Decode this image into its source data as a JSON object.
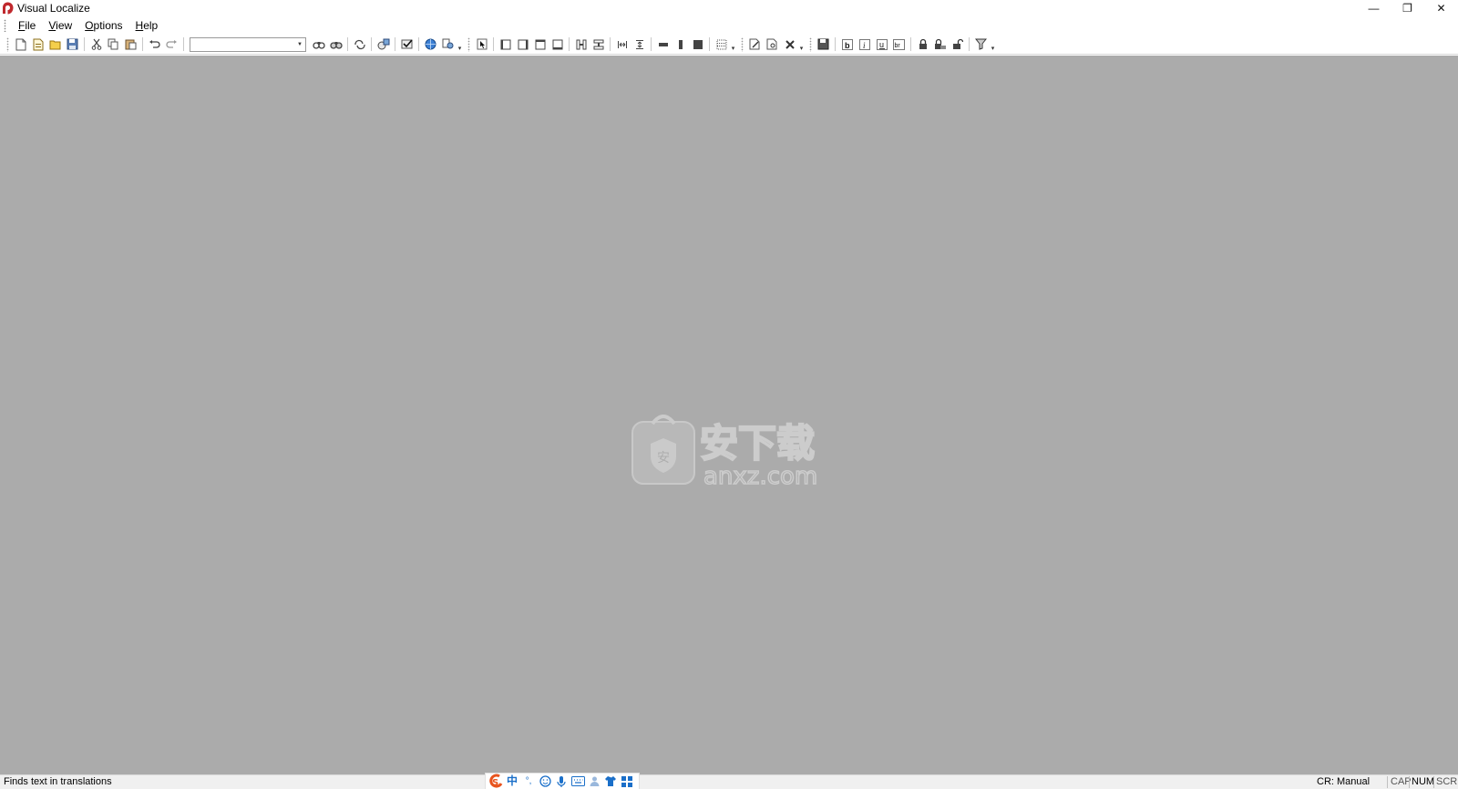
{
  "window": {
    "title": "Visual Localize",
    "controls": {
      "minimize": "—",
      "restore": "❐",
      "close": "✕"
    }
  },
  "menu": {
    "items": [
      {
        "accel": "F",
        "rest": "ile"
      },
      {
        "accel": "V",
        "rest": "iew"
      },
      {
        "accel": "O",
        "rest": "ptions"
      },
      {
        "accel": "H",
        "rest": "elp"
      }
    ]
  },
  "toolbar": {
    "search_combo_value": "",
    "overflow_glyph": "▾"
  },
  "watermark": {
    "cn_text": "安下载",
    "en_text": "anxz.com"
  },
  "status": {
    "message": "Finds text in translations",
    "cr_mode": "CR: Manual",
    "cap": "CAP",
    "num": "NUM",
    "scrl": "SCRL"
  },
  "ime": {
    "lang": "中",
    "punct": "°,"
  },
  "colors": {
    "workspace_bg": "#ababab",
    "app_icon": "#c0282d",
    "ime_brand": "#e8541e",
    "ime_blue": "#1a6fc9"
  }
}
